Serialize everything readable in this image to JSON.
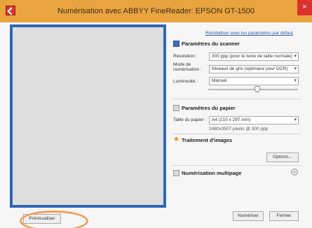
{
  "window": {
    "title": "Numérisation avec ABBYY FineReader: EPSON GT-1500",
    "close_glyph": "×"
  },
  "reset_link": "Réinitialiser avec les paramètres par défaut",
  "scanner": {
    "title": "Paramètres du scanner",
    "resolution_label": "Résolution :",
    "resolution_value": "300 ppp (pour le texte de taille normale)",
    "mode_label_1": "Mode de",
    "mode_label_2": "numérisation :",
    "mode_value": "Niveaux de gris (optimaux pour OCR)",
    "brightness_label": "Luminosité :",
    "brightness_value": "Manuel",
    "brightness_level": 0.55
  },
  "paper": {
    "title": "Paramètres du papier",
    "size_label": "Taille du papier :",
    "size_value": "A4 (210 x 297 mm)",
    "pixels_info": "2480x3507 pixels @ 300 ppp"
  },
  "image_processing": {
    "title": "Traitement d'images",
    "options_button": "Options..."
  },
  "multipage": {
    "title": "Numérisation multipage"
  },
  "footer": {
    "preview_button": "Prévisualiser",
    "scan_button": "Numériser",
    "close_button": "Fermer"
  },
  "colors": {
    "title_bar": "#e9a43f",
    "preview_border": "#2f68b3",
    "highlight_ring": "#f0a05a"
  }
}
